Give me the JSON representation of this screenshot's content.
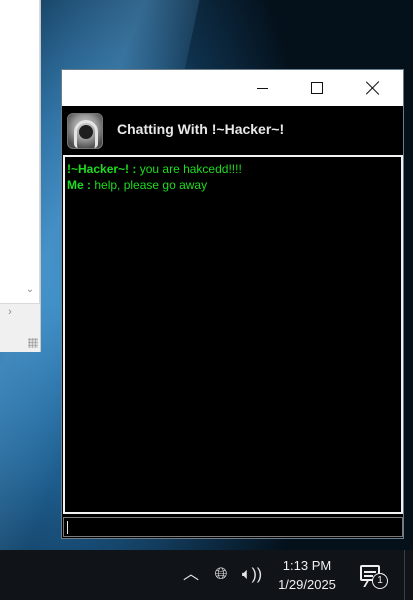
{
  "chat_window": {
    "title": "Chatting With !~Hacker~!",
    "messages": [
      {
        "sender": "!~Hacker~! :",
        "text": "you are hakcedd!!!!"
      },
      {
        "sender": "Me :",
        "text": "help, please go away"
      }
    ],
    "input_value": "",
    "icons": {
      "minimize": "minimize-icon",
      "maximize": "maximize-icon",
      "close": "close-icon",
      "avatar": "hacker-avatar-icon"
    }
  },
  "background_window": {
    "icons": {
      "scroll_down": "chevron-down-icon",
      "scroll_right": "chevron-right-icon",
      "resize": "resize-grip-icon"
    }
  },
  "taskbar": {
    "time": "1:13 PM",
    "date": "1/29/2025",
    "notification_count": "1",
    "icons": {
      "tray_expand": "chevron-up-icon",
      "network": "globe-icon",
      "volume": "volume-icon",
      "notifications": "notification-center-icon"
    }
  },
  "colors": {
    "chat_text": "#1edc1e",
    "chat_background": "#000000",
    "titlebar": "#ffffff",
    "taskbar": "#101418"
  }
}
